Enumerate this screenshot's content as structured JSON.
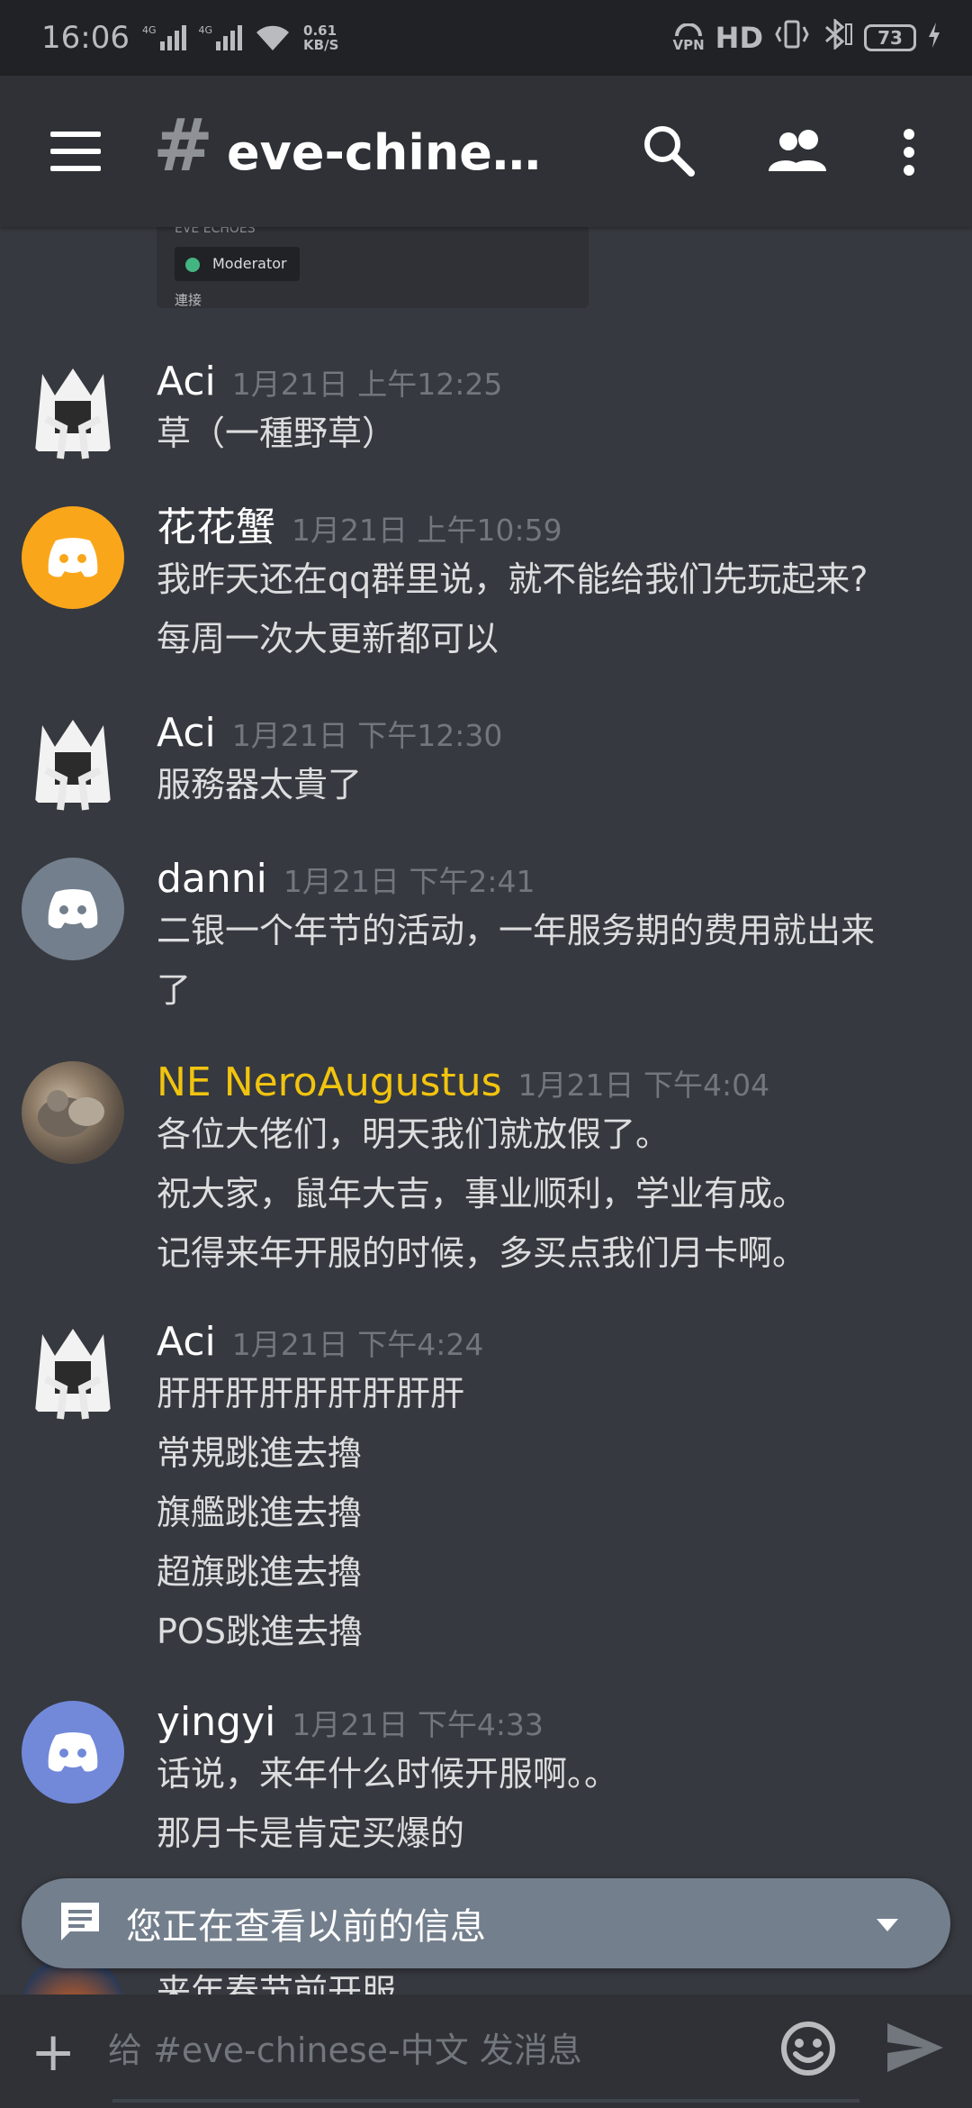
{
  "status_bar": {
    "time": "16:06",
    "signal1_tag": "4G",
    "signal2_tag": "4G",
    "speed_value": "0.61",
    "speed_unit": "KB/S",
    "vpn_label": "VPN",
    "hd_label": "HD",
    "battery": "73"
  },
  "header": {
    "channel_name": "eve-chinese-..."
  },
  "embed": {
    "tiny_caption": "EVE ECHOES",
    "role": "Moderator",
    "link": "連接"
  },
  "messages": [
    {
      "author": "Aci",
      "time": "1月21日 上午12:25",
      "lines": [
        "草（一種野草）"
      ]
    },
    {
      "author": "花花蟹",
      "time": "1月21日 上午10:59",
      "lines": [
        "我昨天还在qq群里说，就不能给我们先玩起来?",
        "每周一次大更新都可以"
      ]
    },
    {
      "author": "Aci",
      "time": "1月21日 下午12:30",
      "lines": [
        "服務器太貴了"
      ]
    },
    {
      "author": "danni",
      "time": "1月21日 下午2:41",
      "lines": [
        "二银一个年节的活动，一年服务期的费用就出来",
        "了"
      ]
    },
    {
      "author": "NE NeroAugustus",
      "time": "1月21日 下午4:04",
      "lines": [
        "各位大佬们，明天我们就放假了。",
        "祝大家，鼠年大吉，事业顺利，学业有成。",
        "记得来年开服的时候，多买点我们月卡啊。"
      ]
    },
    {
      "author": "Aci",
      "time": "1月21日 下午4:24",
      "lines": [
        "肝肝肝肝肝肝肝肝肝",
        "常規跳進去擼",
        "旗艦跳進去擼",
        "超旗跳進去擼",
        "POS跳進去擼"
      ]
    },
    {
      "author": "yingyi",
      "time": "1月21日 下午4:33",
      "lines": [
        "话说，来年什么时候开服啊。。",
        "那月卡是肯定买爆的",
        "来年春节前开服"
      ]
    }
  ],
  "banner": {
    "text": "您正在查看以前的信息"
  },
  "composer": {
    "placeholder": "给 #eve-chinese-中文 发消息"
  },
  "colors": {
    "background": "#36393f",
    "header": "#2f3136",
    "status_bar": "#202225",
    "username_highlight": "#f1c40f",
    "discord_orange": "#faa61a",
    "discord_grey": "#747f8d",
    "discord_blurple": "#7289da",
    "online_green": "#43b581"
  }
}
